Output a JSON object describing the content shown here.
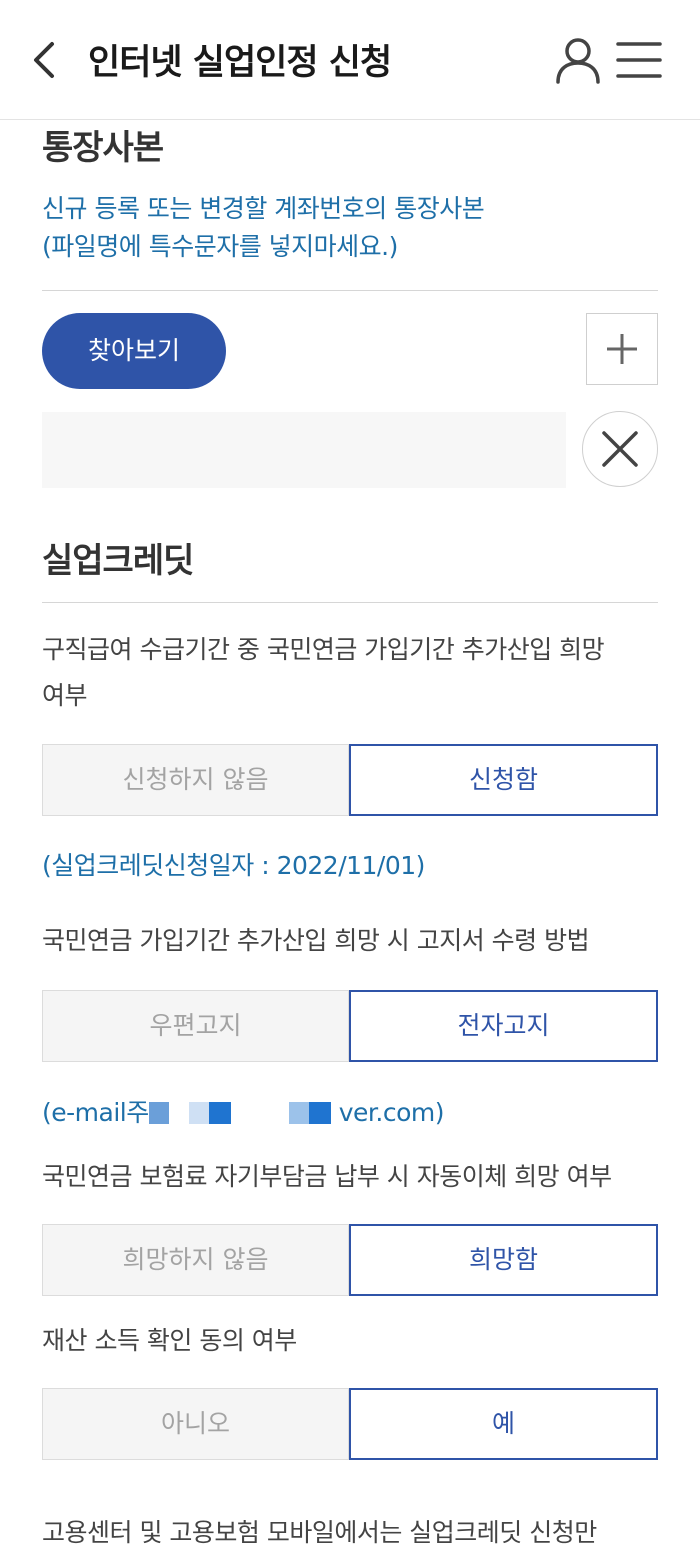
{
  "header": {
    "title": "인터넷 실업인정 신청",
    "icons": [
      "back-chevron-icon",
      "user-icon",
      "hamburger-menu-icon"
    ]
  },
  "bankbook": {
    "title": "통장사본",
    "desc_line1": "신규 등록 또는 변경할 계좌번호의 통장사본",
    "desc_line2": "(파일명에 특수문자를 넣지마세요.)",
    "browse_label": "찾아보기",
    "file_value": ""
  },
  "credit": {
    "title": "실업크레딧",
    "q1_line1": "구직급여 수급기간 중 국민연금 가입기간 추가산입 희망",
    "q1_line2": "여부",
    "q1_opt_no": "신청하지 않음",
    "q1_opt_yes": "신청함",
    "q1_selected": "신청함",
    "date_note": "(실업크레딧신청일자 : 2022/11/01)",
    "q2": "국민연금 가입기간 추가산입 희망 시 고지서 수령 방법",
    "q2_opt_post": "우편고지",
    "q2_opt_email": "전자고지",
    "q2_selected": "전자고지",
    "email_note_prefix": "(e-mail주",
    "email_note_suffix": "ver.com)",
    "q3": "국민연금 보험료 자기부담금 납부 시 자동이체 희망 여부",
    "q3_opt_no": "희망하지 않음",
    "q3_opt_yes": "희망함",
    "q3_selected": "희망함",
    "q4": "재산 소득 확인 동의 여부",
    "q4_opt_no": "아니오",
    "q4_opt_yes": "예",
    "q4_selected": "예",
    "footer_text": "고용센터 및 고용보험 모바일에서는 실업크레딧 신청만"
  },
  "colors": {
    "accent": "#2f54a8",
    "link_text": "#1e6fa8",
    "inactive_text": "#a3a3a3"
  }
}
